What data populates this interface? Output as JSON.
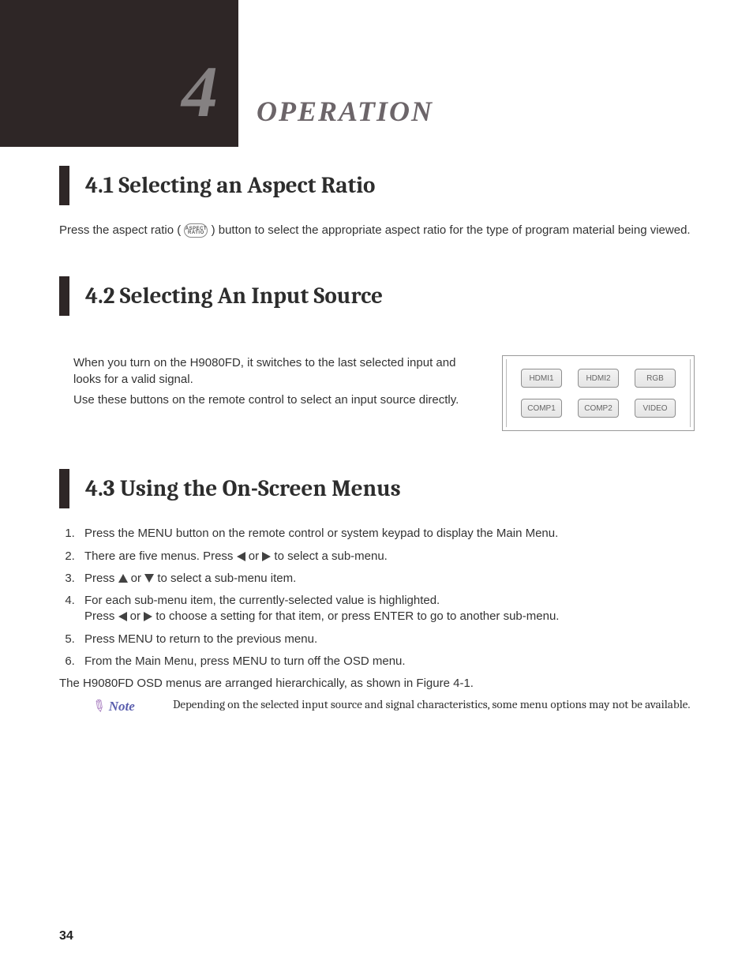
{
  "chapter": {
    "number": "4",
    "title": "OPERATION"
  },
  "section41": {
    "heading": "4.1 Selecting an Aspect Ratio",
    "text_before": "Press the aspect ratio ( ",
    "text_after": " ) button to select the appropriate aspect ratio for the type of program material being viewed.",
    "btn_line1": "ASPECT",
    "btn_line2": "RATIO"
  },
  "section42": {
    "heading": "4.2 Selecting An Input Source",
    "p1": "When you turn on the  H9080FD, it switches to the last selected input and looks for a valid signal.",
    "p2": "Use these buttons on the remote control to select an input source directly.",
    "buttons_row1": [
      "HDMI1",
      "HDMI2",
      "RGB"
    ],
    "buttons_row2": [
      "COMP1",
      "COMP2",
      "VIDEO"
    ]
  },
  "section43": {
    "heading": "4.3 Using the On-Screen Menus",
    "step1": "Press the MENU button on the remote control or system keypad to display the Main Menu.",
    "step2a": "There are five menus. Press ",
    "step2b": " or ",
    "step2c": " to select a sub-menu.",
    "step3a": "Press ",
    "step3b": " or ",
    "step3c": " to select a sub-menu item.",
    "step4a": "For each sub-menu item, the currently-selected value is highlighted.",
    "step4b_pre": "Press ",
    "step4b_mid": " or ",
    "step4b_post": " to choose a setting for that item, or press ENTER to go to another sub-menu.",
    "step5": "Press MENU to return to the previous menu.",
    "step6": "From the Main Menu, press MENU to turn off the OSD menu.",
    "closing": "The H9080FD OSD menus are arranged hierarchically, as shown in Figure 4-1.",
    "note_label": "Note",
    "note_text": "Depending on the selected input source and signal characteristics, some menu options may not be available."
  },
  "page_number": "34"
}
